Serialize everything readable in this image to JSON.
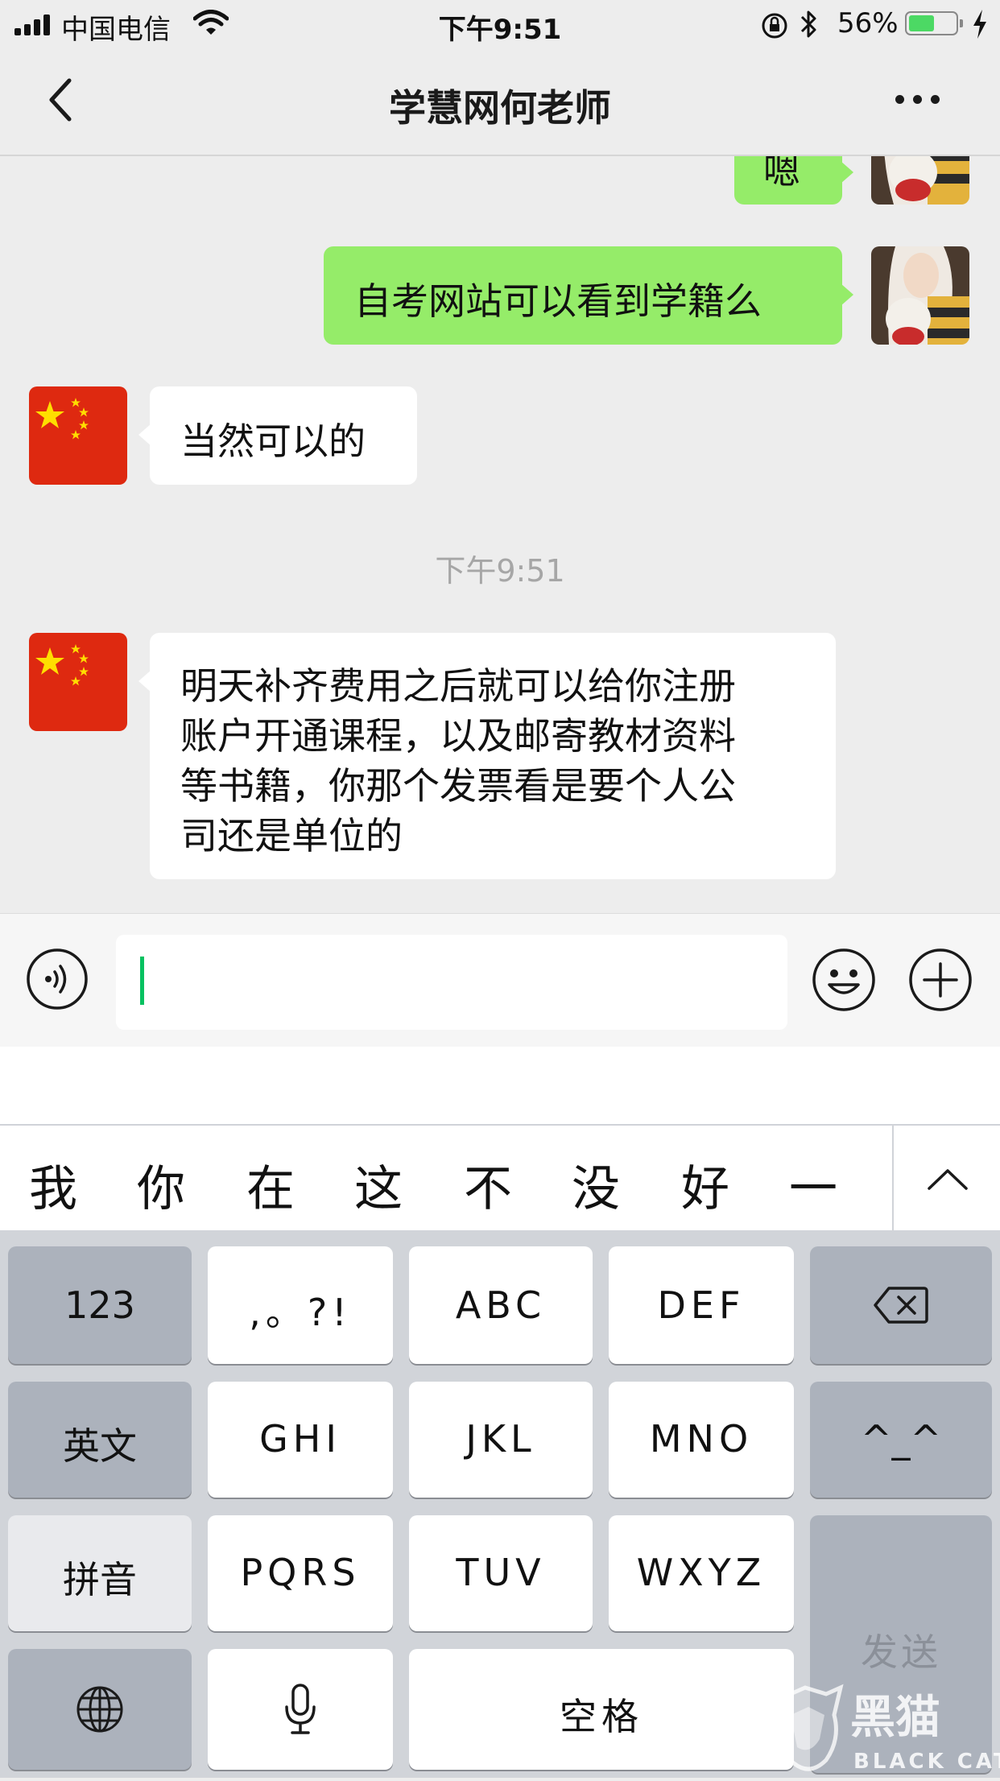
{
  "status_bar": {
    "carrier": "中国电信",
    "time": "下午9:51",
    "battery_percent": "56%",
    "battery_level": 0.56
  },
  "nav": {
    "title": "学慧网何老师"
  },
  "messages": [
    {
      "side": "out",
      "text": "嗯"
    },
    {
      "side": "out",
      "text": "自考网站可以看到学籍么"
    },
    {
      "side": "in",
      "text": "当然可以的"
    },
    {
      "timestamp": "下午9:51"
    },
    {
      "side": "in",
      "lines": [
        "明天补齐费用之后就可以给你注册",
        "账户开通课程，以及邮寄教材资料",
        "等书籍，你那个发票看是要个人公",
        "司还是单位的"
      ]
    }
  ],
  "candidates": [
    "我",
    "你",
    "在",
    "这",
    "不",
    "没",
    "好",
    "一"
  ],
  "keyboard": {
    "row1": [
      "123",
      ",。?!",
      "ABC",
      "DEF"
    ],
    "row2": [
      "英文",
      "GHI",
      "JKL",
      "MNO",
      "^_^"
    ],
    "row3": [
      "拼音",
      "PQRS",
      "TUV",
      "WXYZ"
    ],
    "space": "空格",
    "send": "发送"
  },
  "watermark": {
    "text_cn": "黑猫",
    "text_en": "BLACK CAT"
  },
  "colors": {
    "bubble_out": "#95ec69",
    "bubble_in": "#ffffff",
    "background": "#ededed",
    "caret": "#07c160",
    "battery": "#4cd964"
  },
  "icons": [
    "signal-icon",
    "wifi-icon",
    "orientation-lock-icon",
    "bluetooth-icon",
    "battery-icon",
    "charging-bolt-icon",
    "back-chevron-icon",
    "more-dots-icon",
    "voice-icon",
    "emoji-icon",
    "plus-icon",
    "chevron-up-icon",
    "backspace-icon",
    "globe-icon",
    "microphone-icon"
  ]
}
